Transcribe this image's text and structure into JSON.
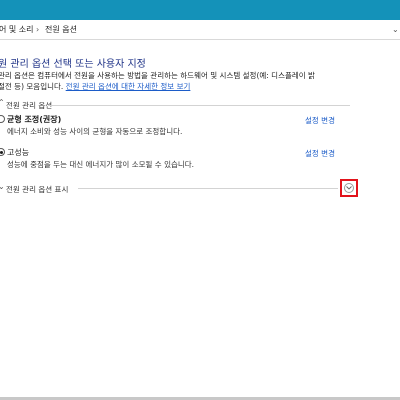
{
  "breadcrumb": {
    "item1": "어 및 소리",
    "item2": "전원 옵션"
  },
  "page": {
    "title": "원 관리 옵션 선택 또는 사용자 지정",
    "description_line1": "관리 옵션은 컴퓨터에서 전원을 사용하는 방법을 관리하는 하드웨어 및 시스템 설정(예: 디스플레이 밝",
    "description_line2_prefix": "절전 등) 모음입니다.",
    "description_link": "전원 관리 옵션에 대한 자세한 정보 보기"
  },
  "selected_plans": {
    "label": "전원 관리 옵션"
  },
  "plans": [
    {
      "name": "균형 조정(권장)",
      "description": "에너지 소비와 성능 사이의 균형을 자동으로 조정합니다.",
      "change_label": "설정 변경",
      "selected": false
    },
    {
      "name": "고성능",
      "description": "성능에 중점을 두는 대신 에너지가 많이 소모될 수 있습니다.",
      "change_label": "설정 변경",
      "selected": true
    }
  ],
  "additional_plans": {
    "label": "전원 관리 옵션 표시"
  },
  "colors": {
    "titlebar": "#1492b9",
    "link": "#1c5cc8",
    "title": "#1e3287",
    "highlight": "#e2131b"
  },
  "icons": {
    "expand": "chevron-down-icon",
    "breadcrumb_separator": "chevron-right-icon"
  }
}
